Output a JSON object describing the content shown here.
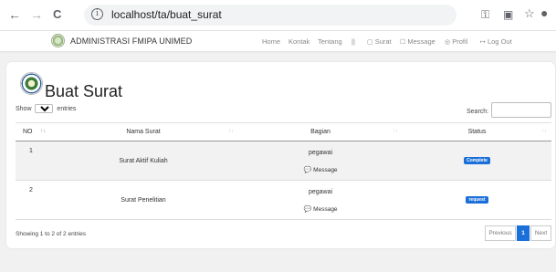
{
  "browser": {
    "back": "←",
    "forward": "→",
    "reload": "C",
    "url": "localhost/ta/buat_surat",
    "key_icon": "key-icon",
    "translate_icon": "translate-icon",
    "star_icon": "star-icon",
    "account_icon": "account-icon"
  },
  "navbar": {
    "brand": "ADMINISTRASI FMIPA UNIMED",
    "items": [
      "Home",
      "Kontak",
      "Tentang",
      "||",
      "Surat",
      "Message",
      "Profil",
      "Log Out"
    ],
    "icons": {
      "surat": "document-icon",
      "message": "chat-icon",
      "profil": "user-icon",
      "logout": "logout-icon"
    }
  },
  "page": {
    "title": "Buat Surat",
    "show_prefix": "Show",
    "page_length": "10",
    "show_suffix": "entries",
    "search_label": "Search:"
  },
  "table": {
    "headers": [
      "NO",
      "Nama Surat",
      "Bagian",
      "Status"
    ],
    "rows": [
      {
        "no": "1",
        "nama": "Surat Aktif Kuliah",
        "bagian": "pegawai",
        "message": "Message",
        "status": "Complete"
      },
      {
        "no": "2",
        "nama": "Surat Penelitian",
        "bagian": "pegawai",
        "message": "Message",
        "status": "request"
      }
    ]
  },
  "footer": {
    "info": "Showing 1 to 2 of 2 entries",
    "previous": "Previous",
    "current_page": "1",
    "next": "Next"
  },
  "colors": {
    "accent": "#1a6fd8",
    "background": "#f1f1f1"
  }
}
